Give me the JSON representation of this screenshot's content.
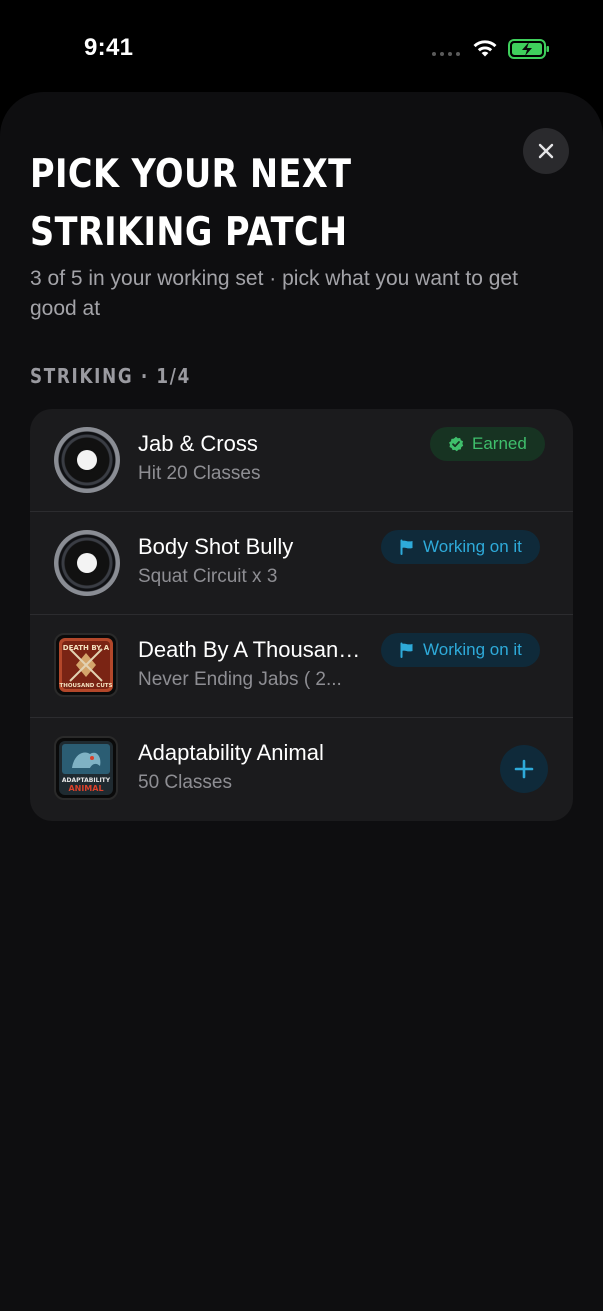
{
  "status_bar": {
    "time": "9:41"
  },
  "sheet": {
    "title": "PICK YOUR NEXT STRIKING PATCH",
    "subtitle": "3 of 5 in your working set · pick what you want to get good at",
    "section_label": "STRIKING · 1/4"
  },
  "patches": [
    {
      "title": "Jab & Cross",
      "subtitle": "Hit 20 Classes",
      "status": "Earned",
      "patch_style": "ring"
    },
    {
      "title": "Body Shot Bully",
      "subtitle": "Squat Circuit x 3",
      "status": "Working on it",
      "patch_style": "ring"
    },
    {
      "title": "Death By A Thousand Cuts",
      "subtitle": "Never Ending Jabs ( 2...",
      "status": "Working on it",
      "patch_style": "image",
      "patch_text": [
        "DEATH BY A",
        "THOUSAND CUTS"
      ]
    },
    {
      "title": "Adaptability Animal",
      "subtitle": "50 Classes",
      "status": "add",
      "patch_style": "image",
      "patch_text": [
        "ADAPTABILITY",
        "ANIMAL"
      ]
    }
  ],
  "colors": {
    "earned_green": "#3fbf6c",
    "working_blue": "#2eaad9",
    "sheet_bg": "#0e0e10",
    "card_bg": "#1b1b1d"
  },
  "icons": {
    "close": "close-icon",
    "earned": "verified-check-icon",
    "working": "flag-icon",
    "add": "plus-icon"
  }
}
